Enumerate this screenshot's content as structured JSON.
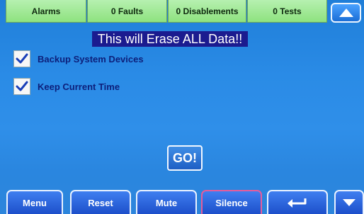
{
  "status_tabs": {
    "alarms": "Alarms",
    "faults": "0 Faults",
    "disablements": "0 Disablements",
    "tests": "0 Tests"
  },
  "warning": "This will Erase ALL Data!!",
  "options": {
    "backup": {
      "label": "Backup System Devices",
      "checked": true
    },
    "keep_time": {
      "label": "Keep Current Time",
      "checked": true
    }
  },
  "go_label": "GO!",
  "bottom_bar": {
    "menu": "Menu",
    "reset": "Reset",
    "mute": "Mute",
    "silence": "Silence"
  },
  "icons": {
    "scroll_up": "triangle-up-icon",
    "enter": "return-arrow-icon",
    "scroll_down": "triangle-down-icon",
    "checkmark": "check-icon"
  },
  "colors": {
    "status_tab": "#8ee27f",
    "warning_bg": "#1b1b8f",
    "silence_border": "#e85b9a"
  }
}
